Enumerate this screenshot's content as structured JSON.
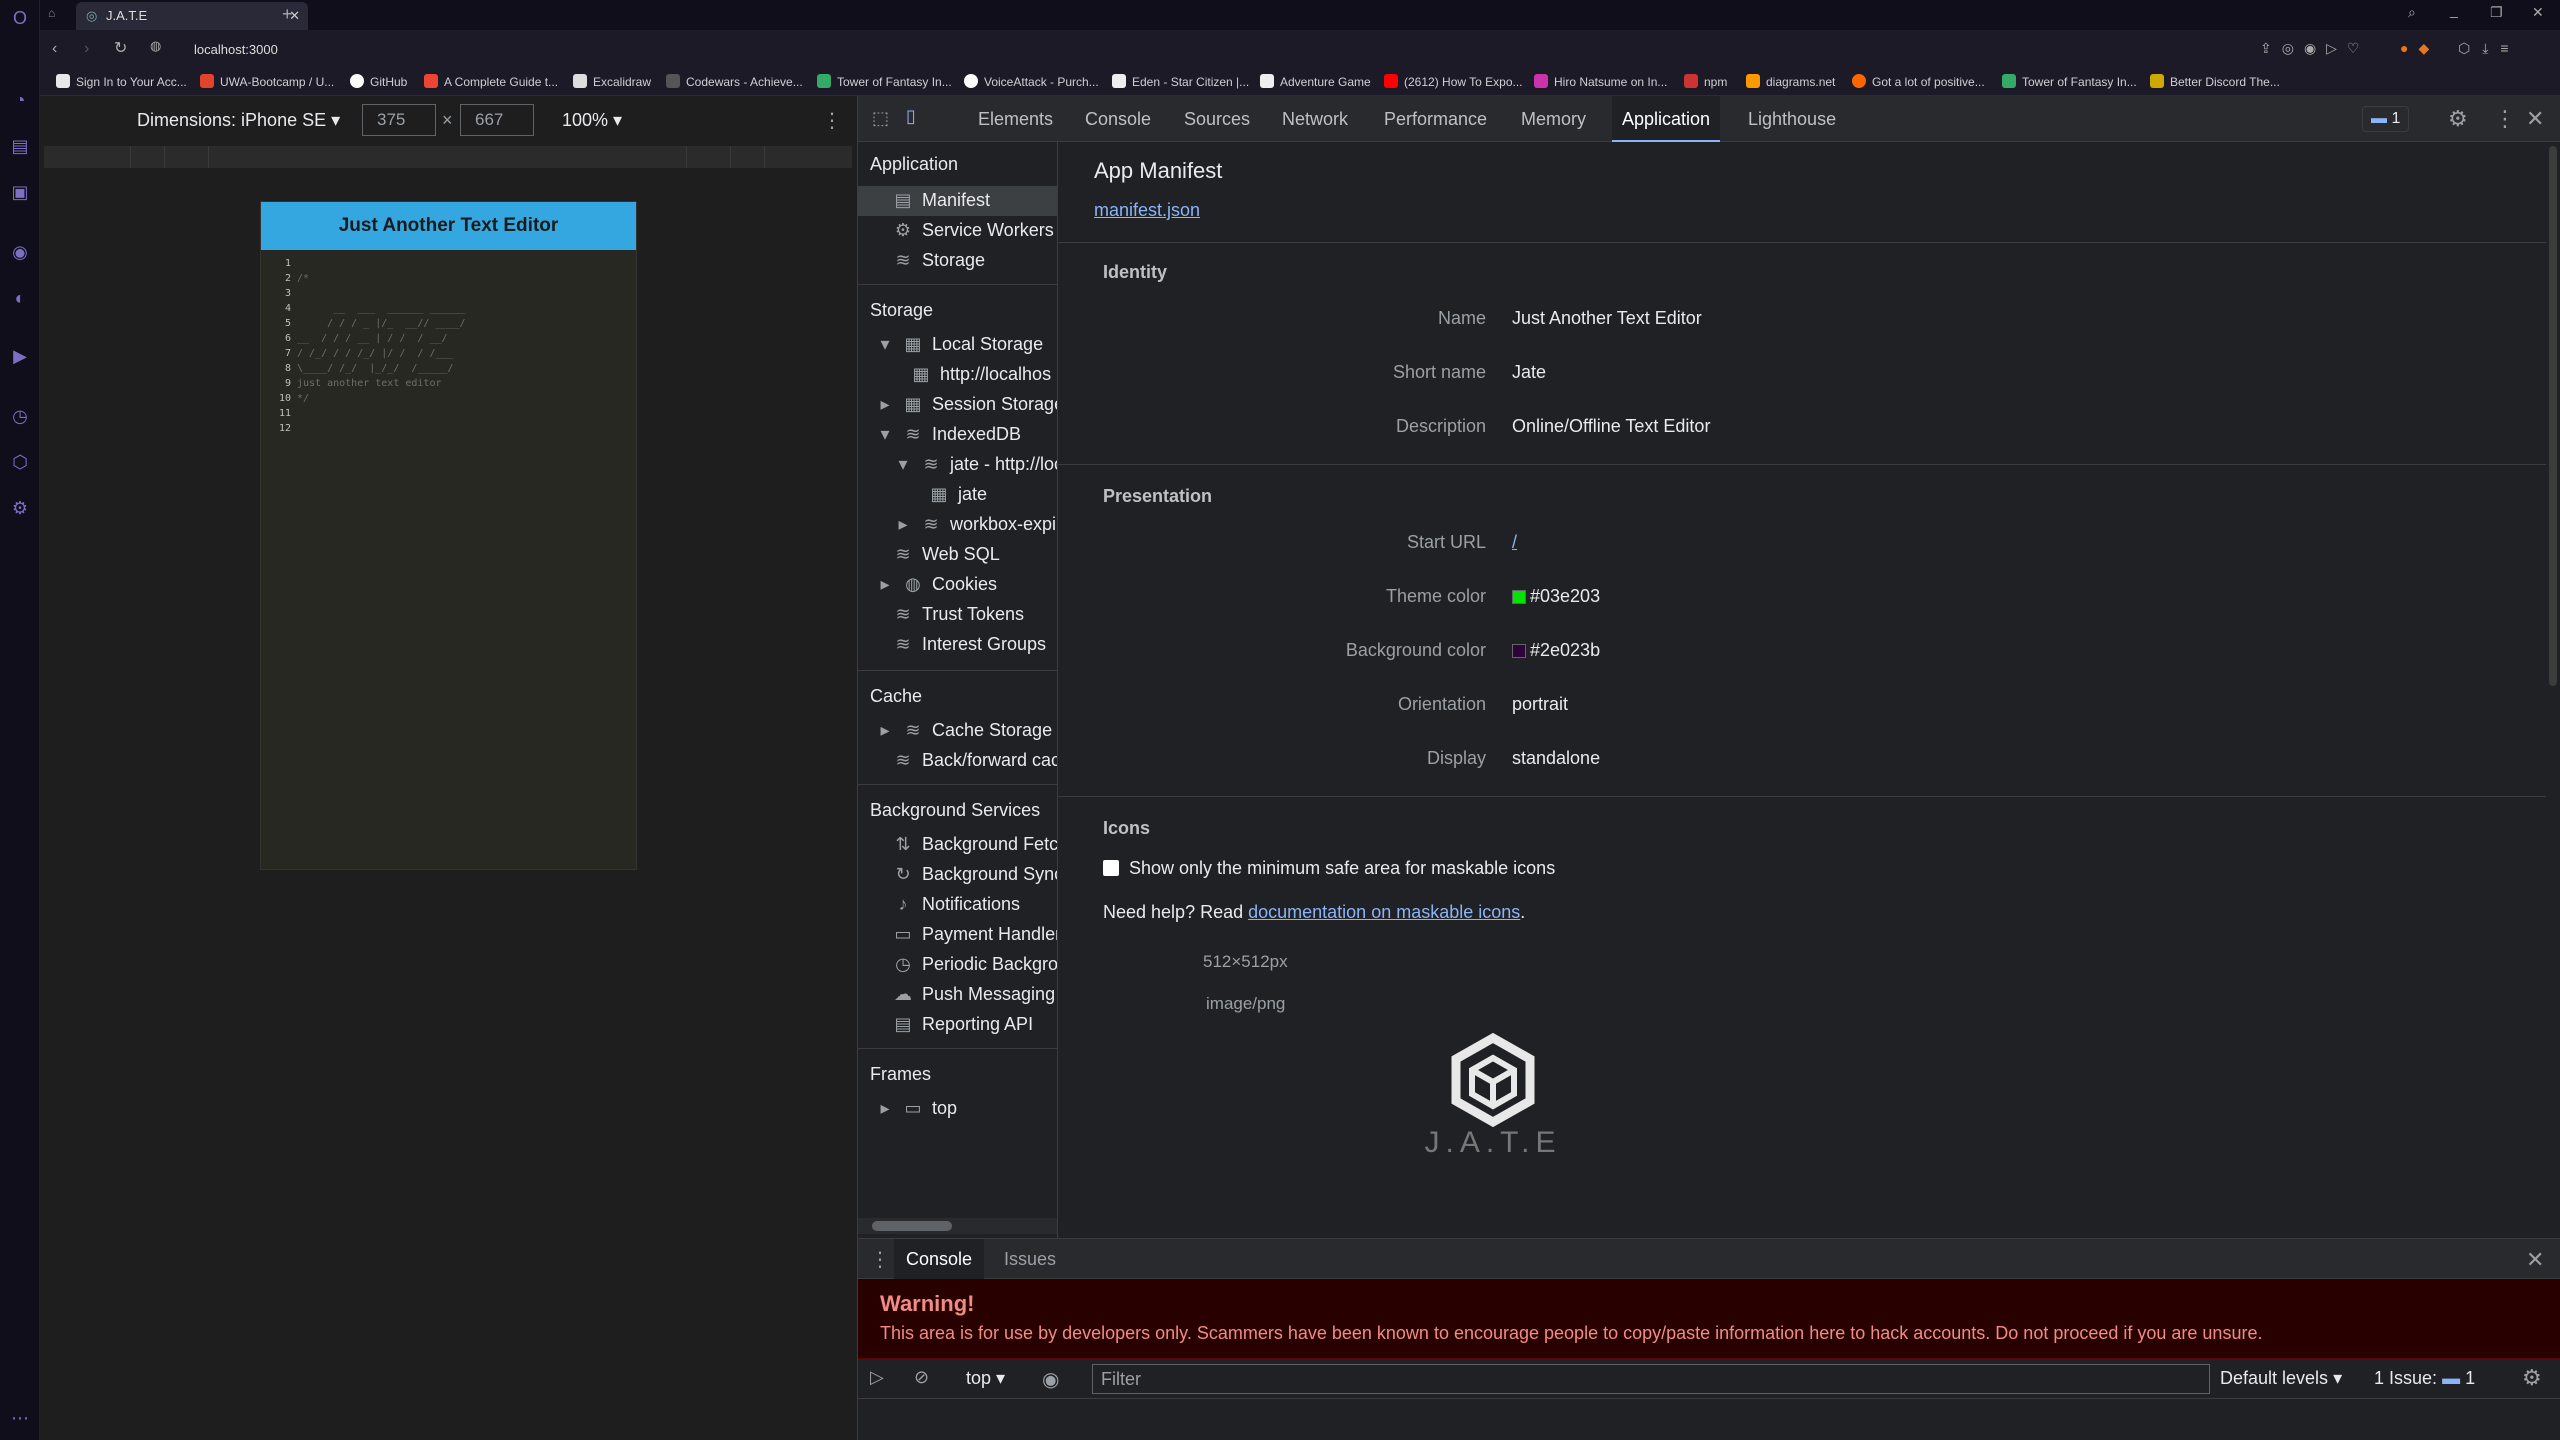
{
  "browser": {
    "tab_title": "J.A.T.E",
    "url": "localhost:3000",
    "bookmarks": [
      "Sign In to Your Acc...",
      "UWA-Bootcamp / U...",
      "GitHub",
      "A Complete Guide t...",
      "Excalidraw",
      "Codewars - Achieve...",
      "Tower of Fantasy In...",
      "VoiceAttack - Purch...",
      "Eden - Star Citizen |...",
      "Adventure Game",
      "(2612) How To Expo...",
      "Hiro Natsume on In...",
      "npm",
      "diagrams.net",
      "Got a lot of positive...",
      "Tower of Fantasy In...",
      "Better Discord The..."
    ]
  },
  "device_toolbar": {
    "dimensions_label": "Dimensions: iPhone SE",
    "width": "375",
    "height": "667",
    "times": "×",
    "zoom": "100%"
  },
  "app": {
    "header": "Just Another Text Editor",
    "line_numbers": [
      "1",
      "2",
      "3",
      "4",
      "5",
      "6",
      "7",
      "8",
      "9",
      "10",
      "11",
      "12"
    ],
    "code_lines": [
      "",
      "/*",
      "",
      "      __  ___  ______ ______",
      "     / / / _ |/_  __// ____/",
      "__  / / / __ | / /  / __/",
      "/ /_/ / / /_/ |/ /  / /___",
      "\\____/ /_/  |_/_/  /_____/",
      "just another text editor",
      "*/",
      "",
      ""
    ]
  },
  "devtools": {
    "tabs": [
      "Elements",
      "Console",
      "Sources",
      "Network",
      "Performance",
      "Memory",
      "Application",
      "Lighthouse"
    ],
    "issues_count": "1",
    "sidebar": {
      "application_header": "Application",
      "application_items": [
        "Manifest",
        "Service Workers",
        "Storage"
      ],
      "storage_header": "Storage",
      "storage_items": [
        "Local Storage",
        "http://localhos",
        "Session Storage",
        "IndexedDB",
        "jate - http://loc",
        "jate",
        "workbox-expir",
        "Web SQL",
        "Cookies",
        "Trust Tokens",
        "Interest Groups"
      ],
      "cache_header": "Cache",
      "cache_items": [
        "Cache Storage",
        "Back/forward cac"
      ],
      "bg_header": "Background Services",
      "bg_items": [
        "Background Fetc",
        "Background Sync",
        "Notifications",
        "Payment Handler",
        "Periodic Backgro",
        "Push Messaging",
        "Reporting API"
      ],
      "frames_header": "Frames",
      "frames_items": [
        "top"
      ]
    },
    "manifest": {
      "title": "App Manifest",
      "link": "manifest.json",
      "identity_header": "Identity",
      "name_label": "Name",
      "name_value": "Just Another Text Editor",
      "short_name_label": "Short name",
      "short_name_value": "Jate",
      "description_label": "Description",
      "description_value": "Online/Offline Text Editor",
      "presentation_header": "Presentation",
      "start_url_label": "Start URL",
      "start_url_value": "/",
      "theme_color_label": "Theme color",
      "theme_color_value": "#03e203",
      "bg_color_label": "Background color",
      "bg_color_value": "#2e023b",
      "orientation_label": "Orientation",
      "orientation_value": "portrait",
      "display_label": "Display",
      "display_value": "standalone",
      "icons_header": "Icons",
      "maskable_checkbox_label": "Show only the minimum safe area for maskable icons",
      "help_prefix": "Need help? Read ",
      "help_link": "documentation on maskable icons",
      "help_suffix": ".",
      "icon_size": "512×512px",
      "icon_type": "image/png",
      "icon_caption": "J.A.T.E"
    },
    "console": {
      "tab_console": "Console",
      "tab_issues": "Issues",
      "warning_title": "Warning!",
      "warning_text": "This area is for use by developers only. Scammers have been known to encourage people to copy/paste information here to hack accounts. Do not proceed if you are unsure.",
      "context": "top",
      "filter_placeholder": "Filter",
      "levels": "Default levels",
      "issues_label": "1 Issue:",
      "issues_num": "1"
    }
  },
  "colors": {
    "theme": "#03e203",
    "background": "#2e023b",
    "header_blue": "#35a7e0"
  }
}
